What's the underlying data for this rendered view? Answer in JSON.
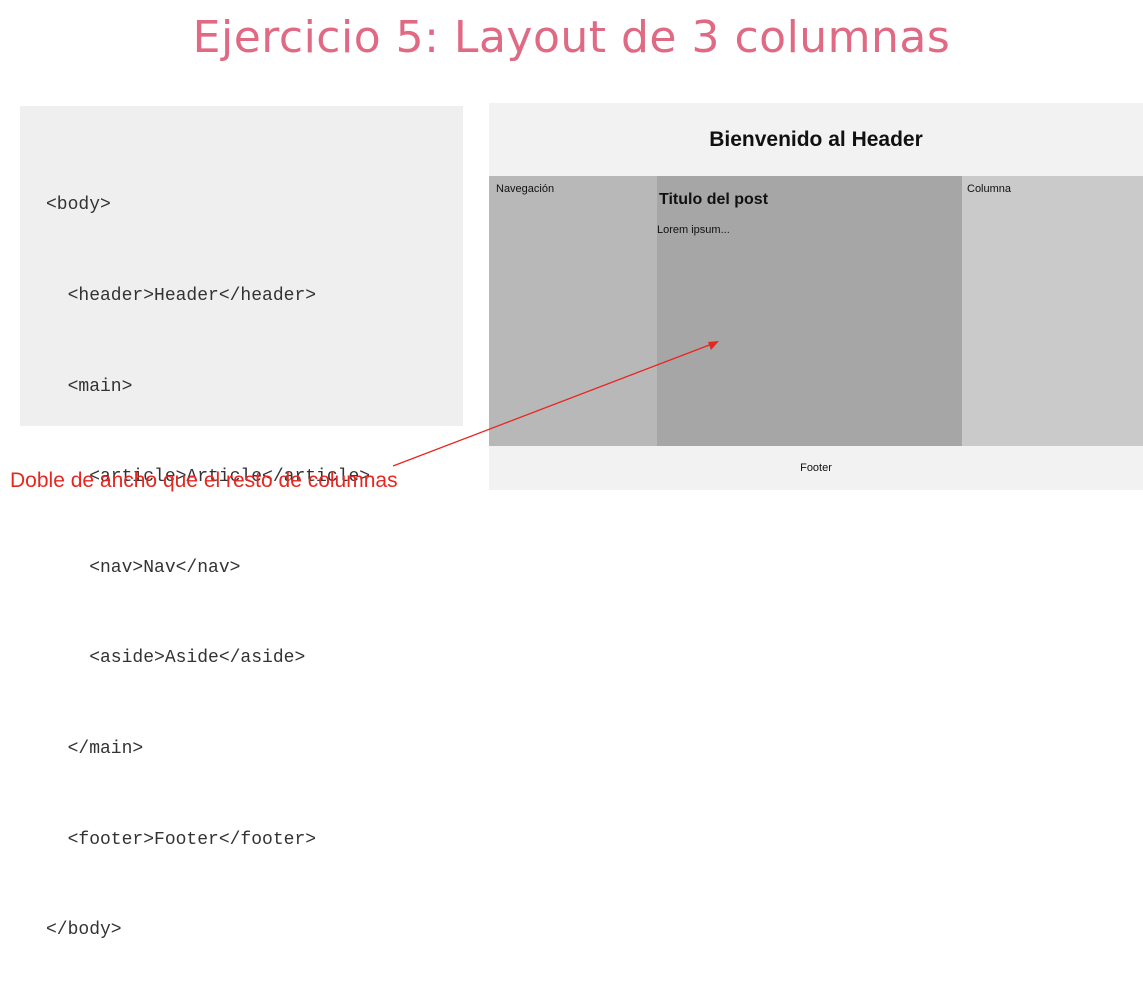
{
  "title": "Ejercicio 5: Layout de 3 columnas",
  "code_lines": [
    "<body>",
    "  <header>Header</header>",
    "  <main>",
    "    <article>Article</article>",
    "    <nav>Nav</nav>",
    "    <aside>Aside</aside>",
    "  </main>",
    "  <footer>Footer</footer>",
    "</body>"
  ],
  "preview": {
    "header": "Bienvenido al Header",
    "nav": "Navegación",
    "article_title": "Titulo del post",
    "article_body": "Lorem ipsum...",
    "aside": "Columna",
    "footer": "Footer"
  },
  "annotation": "Doble de ancho que el resto de columnas",
  "colors": {
    "title": "#e06983",
    "annotation": "#e8261f",
    "code_background": "#efefef"
  }
}
